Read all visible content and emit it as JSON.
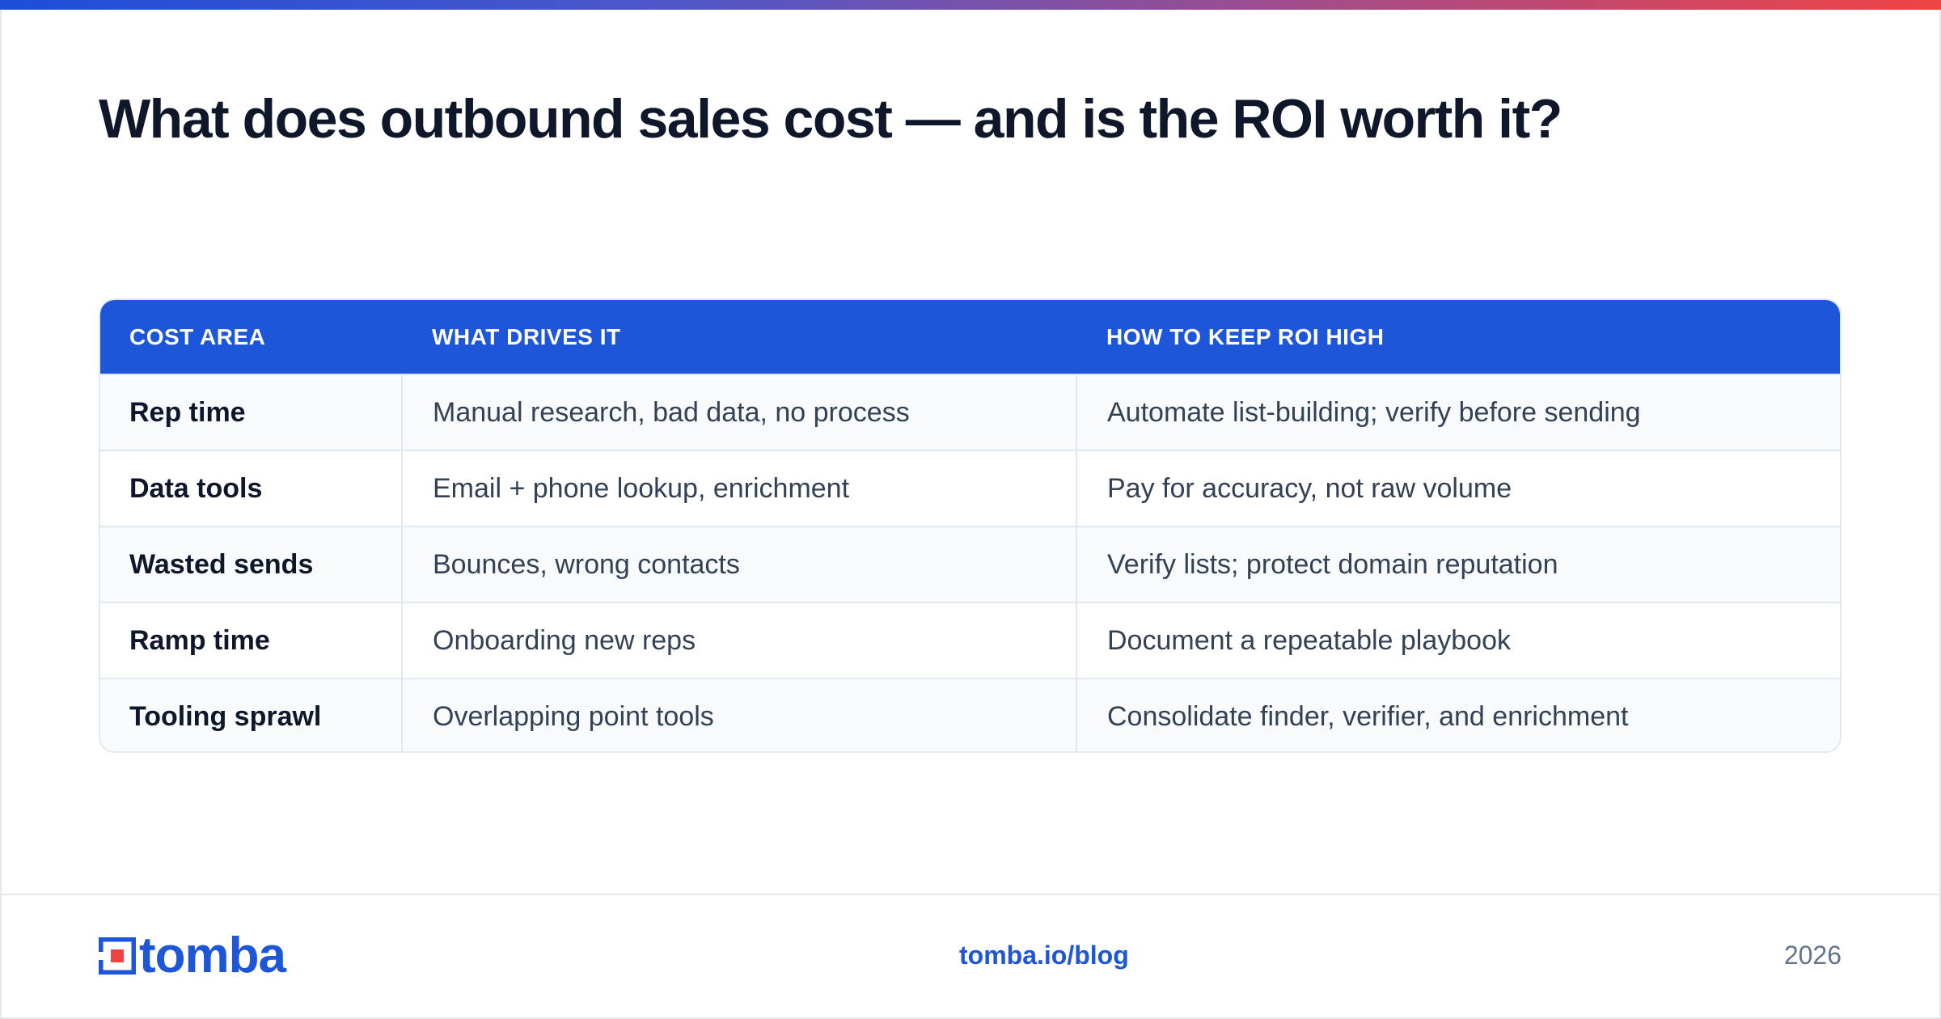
{
  "title": "What does outbound sales cost — and is the ROI worth it?",
  "table": {
    "headers": [
      "COST AREA",
      "WHAT DRIVES IT",
      "HOW TO KEEP ROI HIGH"
    ],
    "rows": [
      [
        "Rep time",
        "Manual research, bad data, no process",
        "Automate list-building; verify before sending"
      ],
      [
        "Data tools",
        "Email + phone lookup, enrichment",
        "Pay for accuracy, not raw volume"
      ],
      [
        "Wasted sends",
        "Bounces, wrong contacts",
        "Verify lists; protect domain reputation"
      ],
      [
        "Ramp time",
        "Onboarding new reps",
        "Document a repeatable playbook"
      ],
      [
        "Tooling sprawl",
        "Overlapping point tools",
        "Consolidate finder, verifier, and enrichment"
      ]
    ]
  },
  "footer": {
    "logo_text": "tomba",
    "link": "tomba.io/blog",
    "year": "2026"
  },
  "colors": {
    "brand_blue": "#1d56d9",
    "accent_red": "#ef4444",
    "text_dark": "#0f172a"
  }
}
